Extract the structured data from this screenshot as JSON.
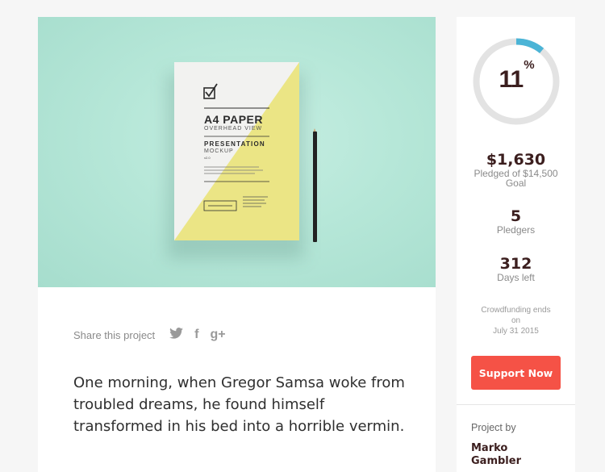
{
  "hero": {
    "paper_title": "A4 PAPER",
    "paper_subtitle": "OVERHEAD VIEW",
    "paper_heading": "PRESENTATION",
    "paper_mockup": "MOCKUP",
    "paper_version": "v2.0",
    "paper_checkbox_icon": "checkbox-icon",
    "accent_yellow": "#ebe585",
    "background_mint": "#b6e7d8"
  },
  "share": {
    "label": "Share this project",
    "icons": [
      "twitter-icon",
      "facebook-icon",
      "google-plus-icon"
    ],
    "facebook_glyph": "f",
    "google_glyph": "g+"
  },
  "description": "One morning, when Gregor Samsa woke from troubled dreams, he found himself transformed in his bed into a horrible vermin.",
  "funding": {
    "percent_number": "11",
    "percent_sign": "%",
    "progress_fraction": 0.11,
    "ring_color": "#4bb4d6",
    "ring_track_color": "#e3e3e3",
    "pledged_amount": "$1,630",
    "pledged_label": "Pledged of $14,500 Goal",
    "pledgers_count": "5",
    "pledgers_label": "Pledgers",
    "days_left": "312",
    "days_label": "Days left",
    "ends_line1": "Crowdfunding ends",
    "ends_line2": "on",
    "ends_date": "July 31 2015",
    "support_button": "Support Now",
    "button_color": "#f55246"
  },
  "author": {
    "label": "Project by",
    "name": "Marko Gambler"
  }
}
